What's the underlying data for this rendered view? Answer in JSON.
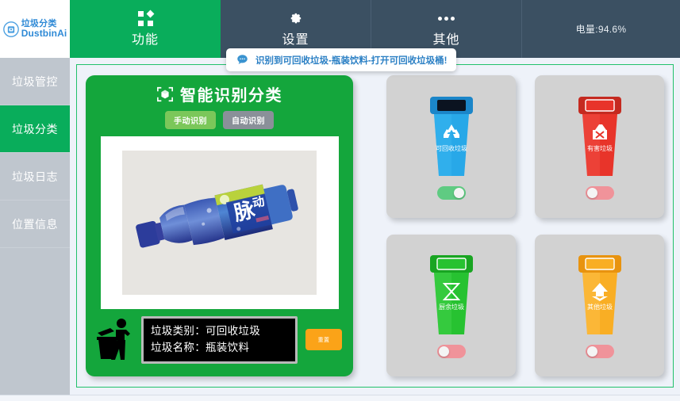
{
  "brand": {
    "logo_icon": "trash-bin-circle-icon",
    "line1": "垃圾分类",
    "line2": "DustbinAi"
  },
  "header": {
    "tabs": [
      {
        "label": "功能",
        "icon": "grid-squares-icon",
        "active": true
      },
      {
        "label": "设置",
        "icon": "gear-icon",
        "active": false
      },
      {
        "label": "其他",
        "icon": "three-dots-icon",
        "active": false
      }
    ],
    "battery": "电量:94.6%"
  },
  "toast": {
    "icon": "chat-bubble-icon",
    "message": "识别到可回收垃圾-瓶装饮料-打开可回收垃圾桶!",
    "color": "#2a7fc4"
  },
  "sidebar": {
    "items": [
      {
        "label": "垃圾管控",
        "active": false
      },
      {
        "label": "垃圾分类",
        "active": true
      },
      {
        "label": "垃圾日志",
        "active": false
      },
      {
        "label": "位置信息",
        "active": false
      }
    ]
  },
  "card": {
    "title": "智能识别分类",
    "title_icon": "cube-scan-icon",
    "modes": [
      {
        "label": "手动识别",
        "state": "selected"
      },
      {
        "label": "自动识别",
        "state": "normal"
      }
    ],
    "photo": {
      "alt_icon": "bottle-photo",
      "subject": "脉动"
    },
    "tidyman_icon": "person-throwing-trash-icon",
    "result": {
      "line1": "垃圾类别：可回收垃圾",
      "line2": "垃圾名称：瓶装饮料"
    },
    "reset_label": "重置"
  },
  "bins": [
    {
      "name": "可回收垃圾",
      "icon": "recycle-icon",
      "color": "#28a8e8",
      "color_dark": "#1b86c9",
      "toggle": "on"
    },
    {
      "name": "有害垃圾",
      "icon": "hazard-flask-icon",
      "color": "#e8342a",
      "color_dark": "#c52a20",
      "toggle": "off"
    },
    {
      "name": "厨余垃圾",
      "icon": "hourglass-icon",
      "color": "#27c231",
      "color_dark": "#19a522",
      "toggle": "off"
    },
    {
      "name": "其他垃圾",
      "icon": "delete-arrow-icon",
      "color": "#f9ae24",
      "color_dark": "#e8930f",
      "toggle": "off"
    }
  ],
  "theme": {
    "accent_green": "#09ad5b",
    "card_green": "#14a63c",
    "header_blue": "#3b5062",
    "sidebar_gray": "#bfc6ce",
    "reset_orange": "#fba318"
  }
}
